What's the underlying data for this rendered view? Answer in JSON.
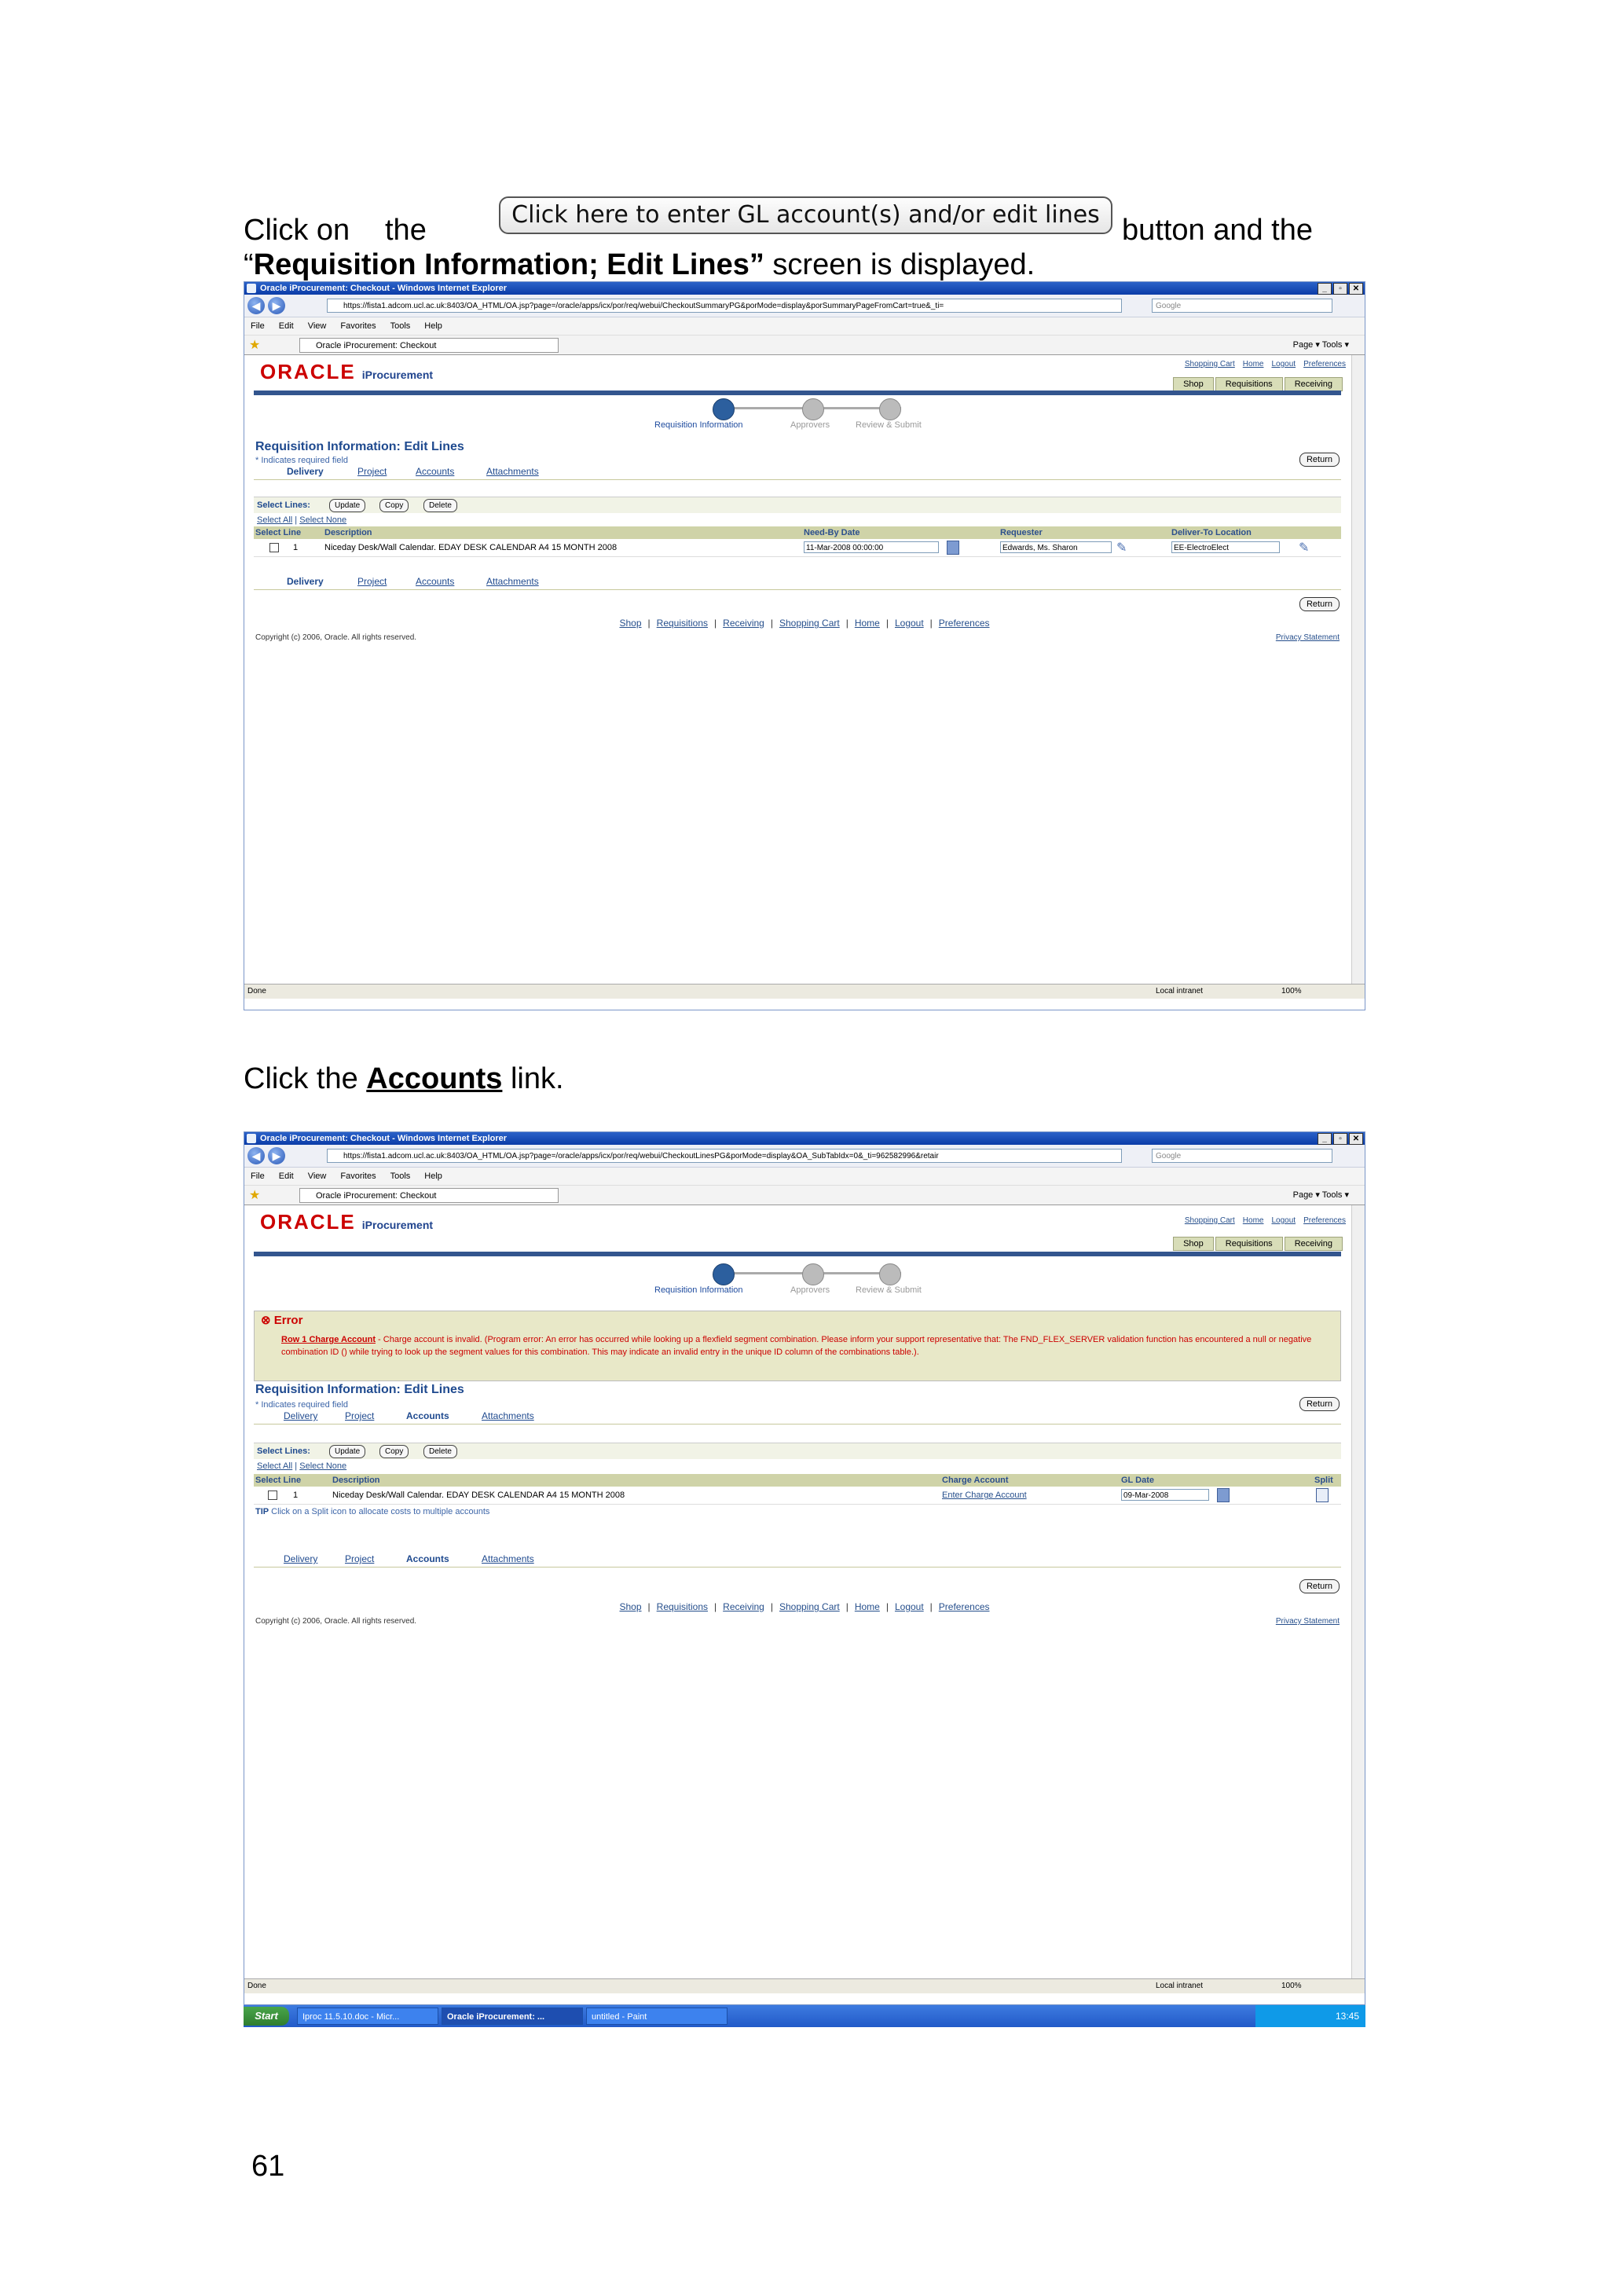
{
  "doc": {
    "line1_click": "Click on",
    "line1_the": "the",
    "inline_button": "Click here to enter GL account(s) and/or edit lines",
    "line1_tail": "button and the",
    "line2_quote_open": "“",
    "line2_bold": "Requisition Information; Edit Lines”",
    "line2_tail": " screen is displayed.",
    "instr2_pre": "Click the ",
    "instr2_link": "Accounts",
    "instr2_post": " link.",
    "page_number": "61"
  },
  "browser1": {
    "title": "Oracle iProcurement: Checkout - Windows Internet Explorer",
    "url": "https://fista1.adcom.ucl.ac.uk:8403/OA_HTML/OA.jsp?page=/oracle/apps/icx/por/req/webui/CheckoutSummaryPG&porMode=display&porSummaryPageFromCart=true&_ti=",
    "search_placeholder": "Google",
    "menu": [
      "File",
      "Edit",
      "View",
      "Favorites",
      "Tools",
      "Help"
    ],
    "tab_title": "Oracle iProcurement: Checkout",
    "toolbar_right": "Page ▾   Tools ▾",
    "status_left": "Done",
    "status_zone": "Local intranet",
    "status_zoom": "100%"
  },
  "browser2": {
    "title": "Oracle iProcurement: Checkout - Windows Internet Explorer",
    "url": "https://fista1.adcom.ucl.ac.uk:8403/OA_HTML/OA.jsp?page=/oracle/apps/icx/por/req/webui/CheckoutLinesPG&porMode=display&OA_SubTabIdx=0&_ti=962582996&retair",
    "search_placeholder": "Google",
    "menu": [
      "File",
      "Edit",
      "View",
      "Favorites",
      "Tools",
      "Help"
    ],
    "tab_title": "Oracle iProcurement: Checkout",
    "toolbar_right": "Page ▾   Tools ▾",
    "status_left": "Done",
    "status_zone": "Local intranet",
    "status_zoom": "100%"
  },
  "app": {
    "logo": "ORACLE",
    "product": "iProcurement",
    "global_links": [
      "Shopping Cart",
      "Home",
      "Logout",
      "Preferences"
    ],
    "global_tabs": [
      "Shop",
      "Requisitions",
      "Receiving"
    ],
    "train": [
      "Requisition Information",
      "Approvers",
      "Review & Submit"
    ],
    "page_header": "Requisition Information: Edit Lines",
    "required_note": "* Indicates required field",
    "return_label": "Return",
    "subtabs": [
      "Delivery",
      "Project",
      "Accounts",
      "Attachments"
    ],
    "select_lines_label": "Select Lines:",
    "select_buttons": [
      "Update",
      "Copy",
      "Delete"
    ],
    "select_all": "Select All",
    "select_none": "Select None",
    "footer_links": [
      "Shop",
      "Requisitions",
      "Receiving",
      "Shopping Cart",
      "Home",
      "Logout",
      "Preferences"
    ],
    "copyright": "Copyright (c) 2006, Oracle. All rights reserved.",
    "privacy": "Privacy Statement"
  },
  "screen1_table": {
    "headers": [
      "Select Line",
      "Description",
      "Need-By Date",
      "Requester",
      "Deliver-To Location"
    ],
    "row": {
      "line": "1",
      "description": "Niceday Desk/Wall Calendar. EDAY DESK CALENDAR A4 15 MONTH 2008",
      "need_by": "11-Mar-2008 00:00:00",
      "requester": "Edwards, Ms. Sharon",
      "location": "EE-ElectroElect"
    }
  },
  "screen2_error": {
    "title": "Error",
    "link": "Row 1 Charge Account",
    "message": " - Charge account is invalid. (Program error: An error has occurred while looking up a flexfield segment combination. Please inform your support representative that: The FND_FLEX_SERVER validation function has encountered a null or negative combination ID () while trying to look up the segment values for this combination. This may indicate an invalid entry in the unique ID column of the combinations table.)."
  },
  "screen2_table": {
    "headers": [
      "Select Line",
      "Description",
      "Charge Account",
      "GL Date",
      "Split"
    ],
    "row": {
      "line": "1",
      "description": "Niceday Desk/Wall Calendar. EDAY DESK CALENDAR A4 15 MONTH 2008",
      "charge_account": "Enter Charge Account",
      "gl_date": "09-Mar-2008"
    },
    "tip_label": "TIP",
    "tip_text": " Click on a Split icon to allocate costs to multiple accounts"
  },
  "taskbar": {
    "start": "Start",
    "items": [
      "Iproc 11.5.10.doc - Micr...",
      "Oracle iProcurement: ...",
      "untitled - Paint"
    ],
    "clock": "13:45"
  }
}
